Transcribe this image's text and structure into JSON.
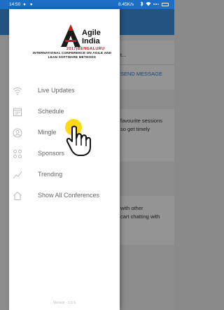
{
  "status_bar": {
    "time": "14:50",
    "network_speed": "8.45K/s",
    "left_icons": "● ●",
    "right_icons": [
      "bluetooth-icon",
      "wifi-icon",
      "signal-icon",
      "battery-icon"
    ]
  },
  "background": {
    "header_color": "#3f8fe0",
    "snippets": [
      {
        "text": "t...",
        "kind": "text"
      },
      {
        "text": "SEND MESSAGE",
        "kind": "link"
      },
      {
        "text": "favourite sessions",
        "kind": "text"
      },
      {
        "text": "so get timely",
        "kind": "text"
      },
      {
        "text": "with other",
        "kind": "text"
      },
      {
        "text": "cart chatting with",
        "kind": "text"
      }
    ]
  },
  "drawer": {
    "logo": {
      "line1": "Agile",
      "line2": "India",
      "year_city": "2017|BENGALURU",
      "conference": "INTERNATIONAL CONFERENCE ON AGILE AND LEAN SOFTWARE METHODS"
    },
    "menu": [
      {
        "label": "Live Updates",
        "icon": "wifi-icon"
      },
      {
        "label": "Schedule",
        "icon": "calendar-icon"
      },
      {
        "label": "Mingle",
        "icon": "person-icon"
      },
      {
        "label": "Sponsors",
        "icon": "grid-dots-icon"
      },
      {
        "label": "Trending",
        "icon": "trend-line-icon"
      },
      {
        "label": "Show All Conferences",
        "icon": "home-icon"
      }
    ],
    "version": "Version - 1.6.6"
  },
  "colors": {
    "status_bar": "#1c6fc4",
    "logo_accent": "#c21818",
    "touch_indicator": "#ffd400"
  }
}
